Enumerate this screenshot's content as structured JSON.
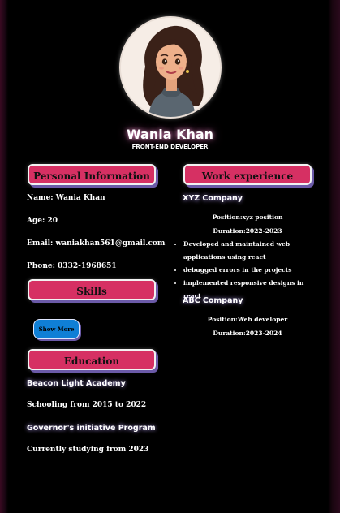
{
  "profile": {
    "name": "Wania Khan",
    "role": "FRONT-END DEVELOPER"
  },
  "personal": {
    "heading": "Personal Information",
    "name": "Name: Wania Khan",
    "age": "Age: 20",
    "email": "Email: waniakhan561@gmail.com",
    "phone": "Phone: 0332-1968651"
  },
  "skills": {
    "heading": "Skills",
    "show_more": "Show More"
  },
  "education": {
    "heading": "Education",
    "items": [
      {
        "school": "Beacon Light Academy",
        "detail": "Schooling from 2015 to 2022"
      },
      {
        "school": "Governor's initiative Program",
        "detail": "Currently studying from 2023"
      }
    ]
  },
  "work": {
    "heading": "Work experience",
    "jobs": [
      {
        "company": "XYZ Company",
        "position": "Position:xyz position",
        "duration": "Duration:2022-2023",
        "duties": [
          "Developed and maintained web applications using react",
          "debugged errors in the projects",
          "implemented responsive designs in react"
        ]
      },
      {
        "company": "ABC Company",
        "position": "Position:Web developer",
        "duration": "Duration:2023-2024"
      }
    ]
  },
  "colors": {
    "accent": "#d63063",
    "button": "#0f7fd6",
    "background": "#000000"
  }
}
